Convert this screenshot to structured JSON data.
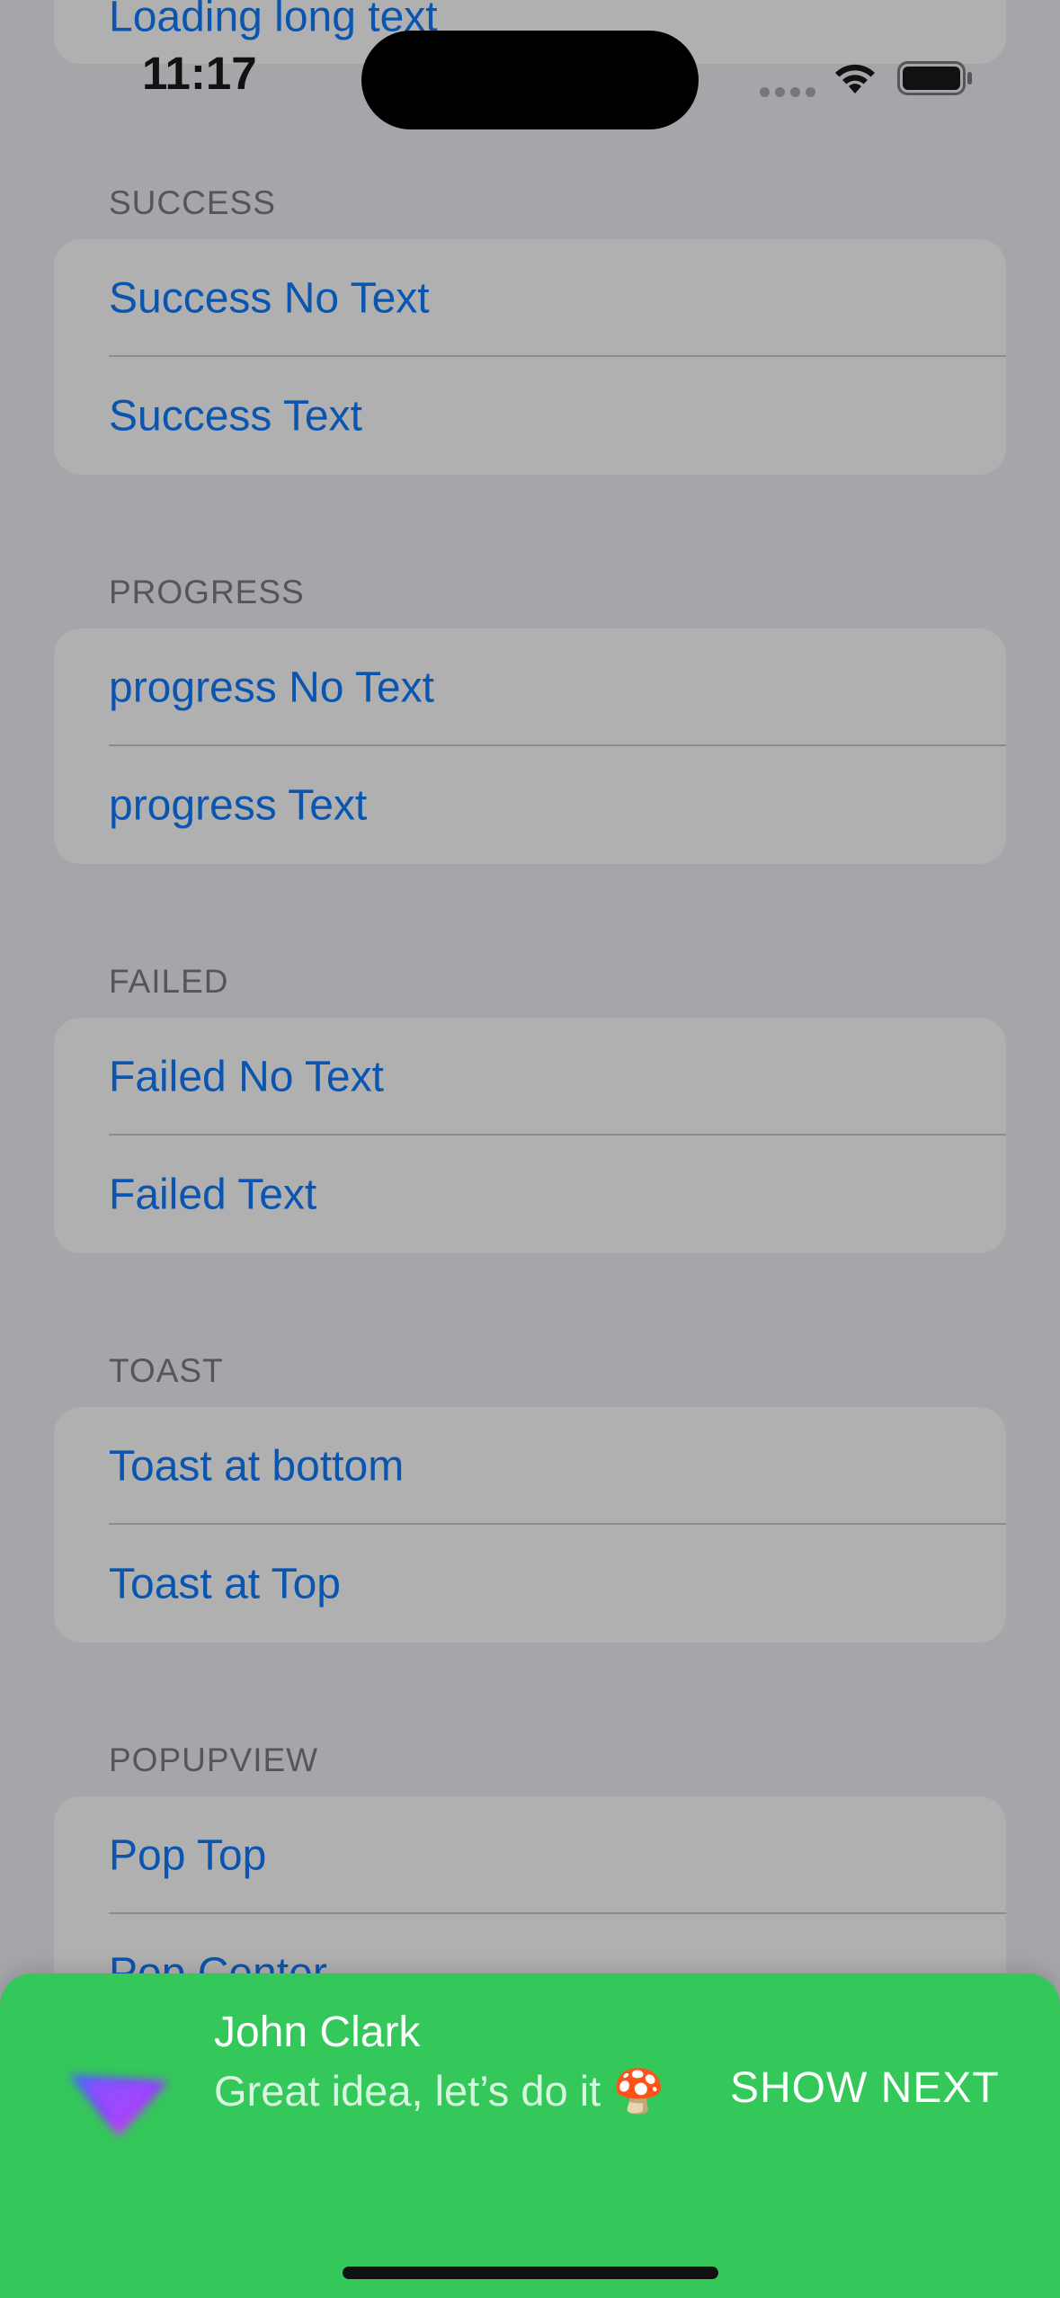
{
  "status_bar": {
    "time": "11:17"
  },
  "list": {
    "top_card_label": "Loading long text",
    "sections": [
      {
        "header": "SUCCESS",
        "items": [
          "Success No Text",
          "Success Text"
        ]
      },
      {
        "header": "PROGRESS",
        "items": [
          "progress No Text",
          "progress Text"
        ]
      },
      {
        "header": "FAILED",
        "items": [
          "Failed No Text",
          "Failed Text"
        ]
      },
      {
        "header": "TOAST",
        "items": [
          "Toast at bottom",
          "Toast at Top"
        ]
      },
      {
        "header": "POPUPVIEW",
        "items": [
          "Pop Top",
          "Pop Center"
        ]
      }
    ]
  },
  "toast": {
    "name": "John Clark",
    "message": "Great idea, let’s do it 🍄",
    "action": "SHOW NEXT",
    "background": "#34c759"
  },
  "colors": {
    "link": "#0a55b0",
    "overlay_background": "#a6a5aa",
    "card_background": "#b0b0b0"
  }
}
